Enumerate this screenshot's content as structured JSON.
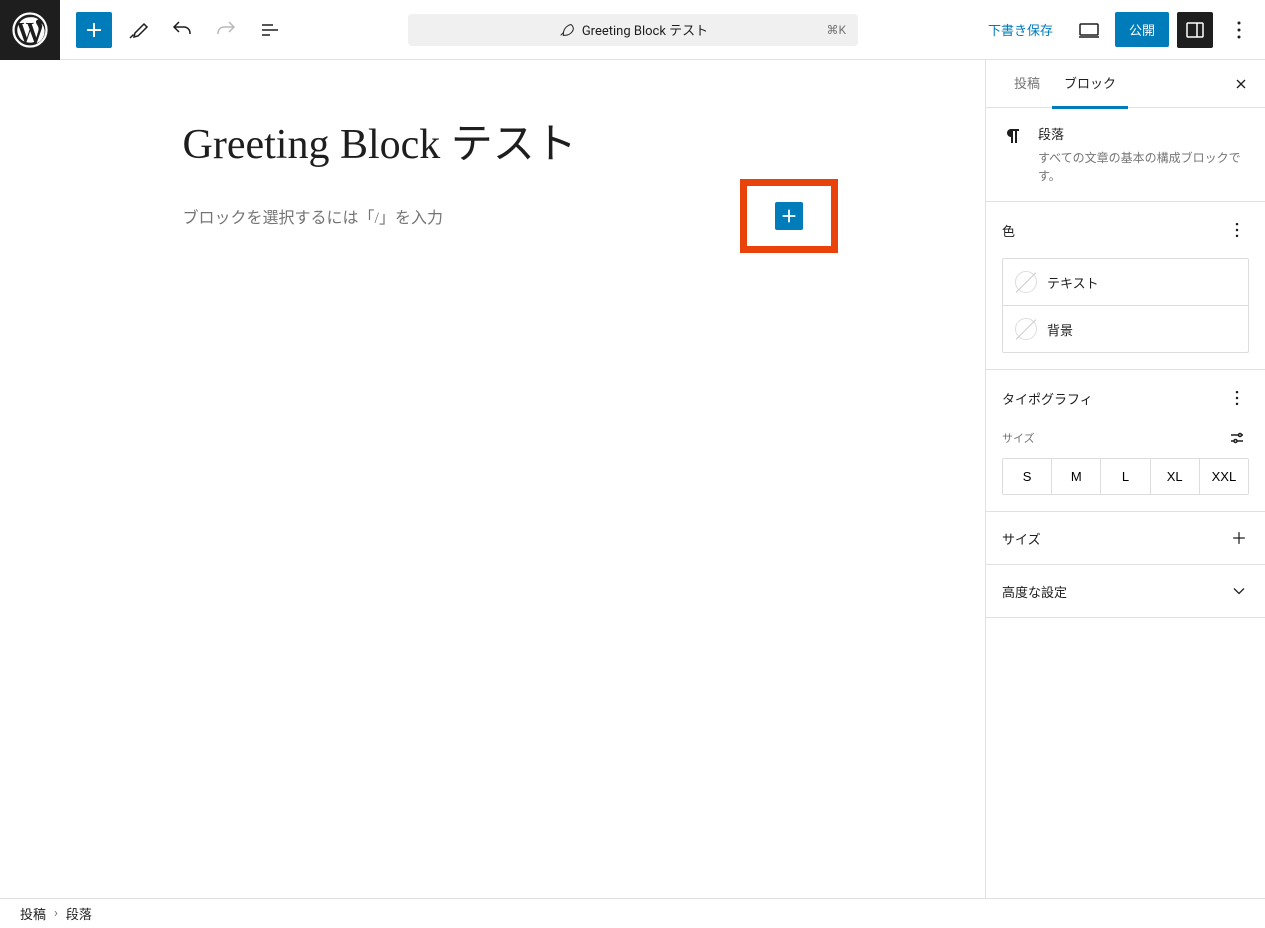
{
  "toolbar": {
    "doc_title": "Greeting Block テスト",
    "shortcut": "⌘K",
    "save_draft": "下書き保存",
    "publish": "公開"
  },
  "content": {
    "title": "Greeting Block テスト",
    "placeholder": "ブロックを選択するには「/」を入力"
  },
  "sidebar": {
    "tabs": {
      "post": "投稿",
      "block": "ブロック"
    },
    "block_info": {
      "title": "段落",
      "desc": "すべての文章の基本の構成ブロックです。"
    },
    "panels": {
      "color": {
        "title": "色",
        "text_label": "テキスト",
        "background_label": "背景"
      },
      "typography": {
        "title": "タイポグラフィ",
        "size_label": "サイズ",
        "sizes": [
          "S",
          "M",
          "L",
          "XL",
          "XXL"
        ]
      },
      "size": {
        "title": "サイズ"
      },
      "advanced": {
        "title": "高度な設定"
      }
    }
  },
  "footer": {
    "crumb1": "投稿",
    "crumb2": "段落"
  }
}
